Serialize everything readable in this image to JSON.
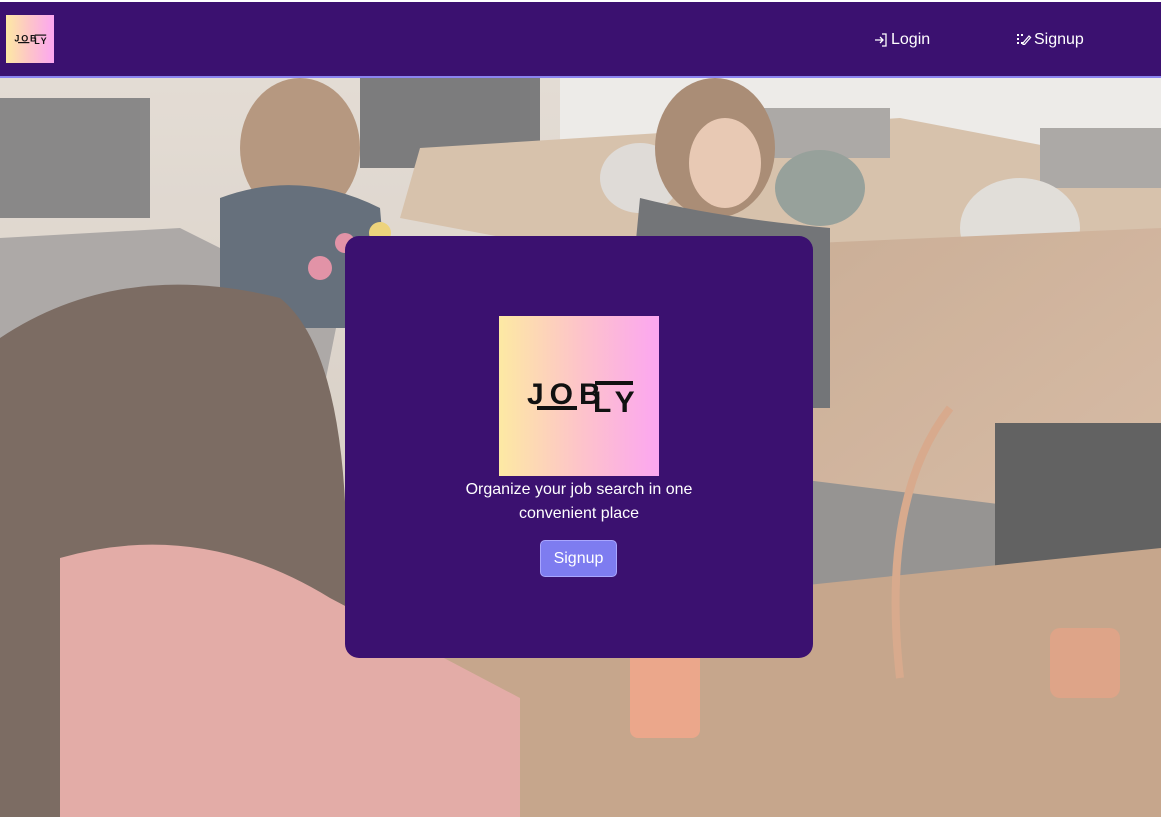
{
  "navbar": {
    "logo_text": "JOBLY",
    "logo_icon": "jobly-logo",
    "links": [
      {
        "label": "Login",
        "icon": "login-arrow-icon"
      },
      {
        "label": "Signup",
        "icon": "signup-pencil-icon"
      }
    ]
  },
  "hero": {
    "background": "office-workspace-photo"
  },
  "card": {
    "logo_text": "JOBLY",
    "tagline": "Organize your job search in one convenient place",
    "signup_label": "Signup"
  },
  "colors": {
    "brand_purple": "#3b1170",
    "accent_button": "#7e7cf0",
    "navbar_border": "#8b84f0",
    "logo_gradient_start": "#fde9a3",
    "logo_gradient_end": "#fca6f1"
  }
}
